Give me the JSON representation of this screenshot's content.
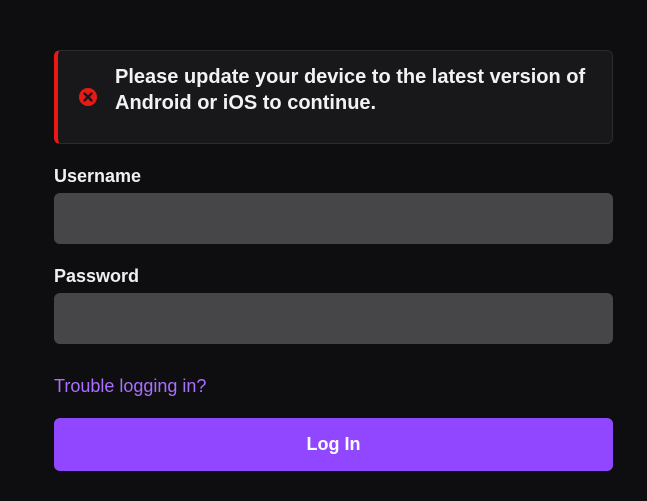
{
  "alert": {
    "icon": "error-circle-icon",
    "message": "Please update your device to the latest version of Android or iOS to continue.",
    "accent_color": "#e91916"
  },
  "form": {
    "username_label": "Username",
    "username_value": "",
    "password_label": "Password",
    "password_value": "",
    "trouble_link": "Trouble logging in?",
    "login_button": "Log In"
  },
  "colors": {
    "background": "#0e0d0f",
    "input": "#464649",
    "link": "#a970ff",
    "button": "#9147ff"
  }
}
